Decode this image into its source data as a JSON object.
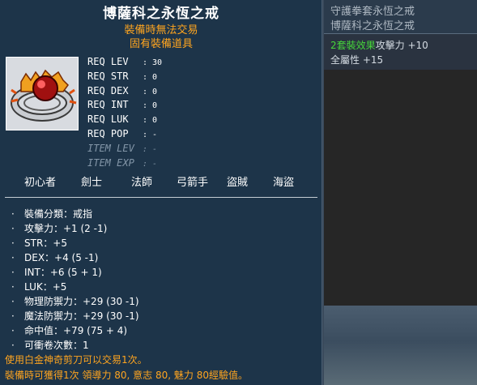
{
  "tooltip": {
    "title": "博薩科之永恆之戒",
    "warnings": [
      "裝備時無法交易",
      "固有裝備道具"
    ],
    "requirements": [
      {
        "label": "REQ LEV",
        "value": ": 30"
      },
      {
        "label": "REQ STR",
        "value": ": 0"
      },
      {
        "label": "REQ DEX",
        "value": ": 0"
      },
      {
        "label": "REQ INT",
        "value": ": 0"
      },
      {
        "label": "REQ LUK",
        "value": ": 0"
      },
      {
        "label": "REQ POP",
        "value": ": -"
      },
      {
        "label": "ITEM LEV",
        "value": ": -"
      },
      {
        "label": "ITEM EXP",
        "value": ": -"
      }
    ],
    "jobs": [
      "初心者",
      "劍士",
      "法師",
      "弓箭手",
      "盜賊",
      "海盜"
    ],
    "stats": [
      "裝備分類：戒指",
      "攻擊力：+1 (2 -1)",
      "STR：+5",
      "DEX：+4 (5 -1)",
      "INT：+6 (5 + 1)",
      "LUK：+5",
      "物理防禦力：+29 (30 -1)",
      "魔法防禦力：+29 (30 -1)",
      "命中值：+79 (75 + 4)",
      "可衝卷次數：1"
    ],
    "notes": [
      "使用白金神奇剪刀可以交易1次。",
      "裝備時可獲得1次 領導力 80, 意志 80, 魅力 80經驗值。"
    ],
    "icon": "ruby-ring-icon"
  },
  "set_panel": {
    "lines": [
      "守護拳套永恆之戒",
      "博薩科之永恆之戒"
    ],
    "effect_label": "2套裝效果",
    "effect_stat1": "攻擊力 +10",
    "effect_stat2": "全屬性 +15"
  },
  "colors": {
    "warning": "#ffa51f",
    "set_green": "#46d63a",
    "panel_bg": "#1d3449"
  }
}
